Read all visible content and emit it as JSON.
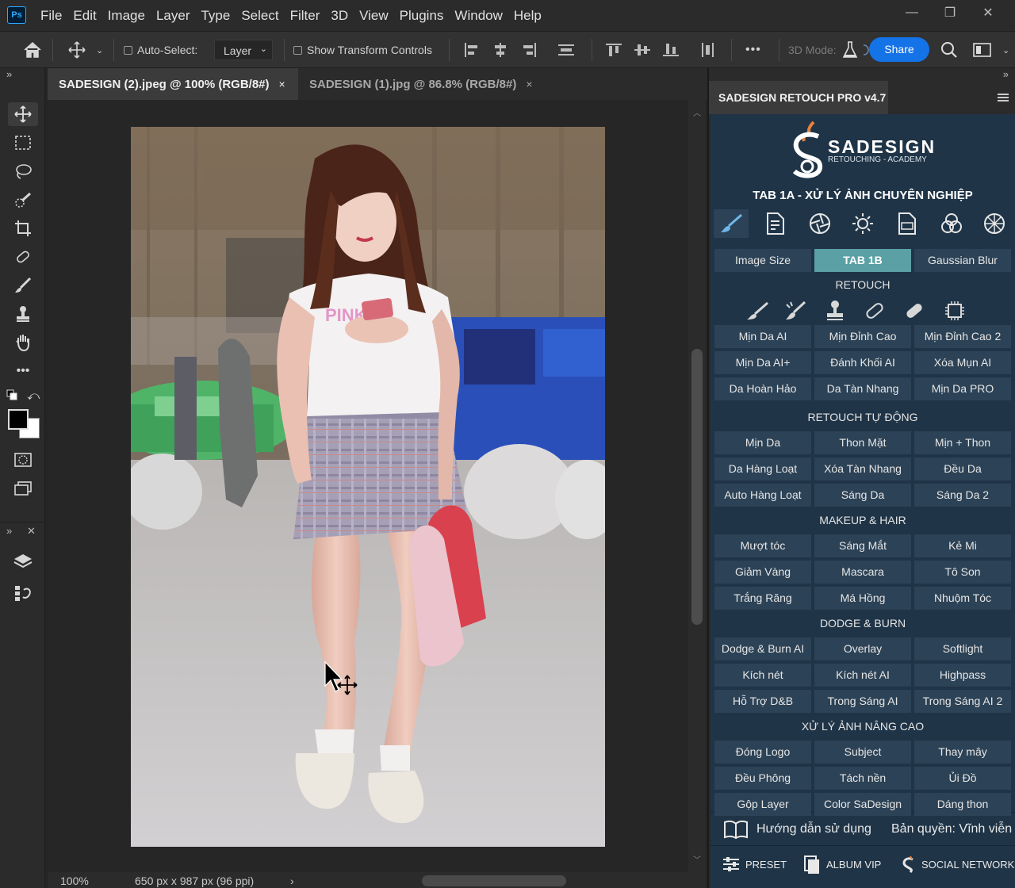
{
  "app": {
    "logo": "Ps",
    "menu": [
      "File",
      "Edit",
      "Image",
      "Layer",
      "Type",
      "Select",
      "Filter",
      "3D",
      "View",
      "Plugins",
      "Window",
      "Help"
    ],
    "window_controls": [
      "—",
      "❐",
      "✕"
    ]
  },
  "options": {
    "auto_select_label": "Auto-Select:",
    "auto_select_target": "Layer",
    "show_transform_label": "Show Transform Controls",
    "more": "•••",
    "mode_3d_label": "3D Mode:",
    "share_label": "Share"
  },
  "toolbar": {
    "collapse": "»",
    "panel_collapse": "»",
    "panel_close": "✕"
  },
  "documents": [
    {
      "title": "SADESIGN (2).jpeg @ 100% (RGB/8#)",
      "close": "×",
      "active": true
    },
    {
      "title": "SADESIGN (1).jpg @ 86.8% (RGB/8#)",
      "close": "×",
      "active": false
    }
  ],
  "status": {
    "zoom": "100%",
    "doc_info": "650 px x 987 px (96 ppi)",
    "arrow": "›"
  },
  "panel": {
    "expand": "»",
    "title": "SADESIGN RETOUCH PRO v4.7",
    "menu_icon": "hamburger-icon"
  },
  "plugin": {
    "brand_name": "SADESIGN",
    "brand_sub": "RETOUCHING - ACADEMY",
    "heading": "TAB 1A - XỬ LÝ ẢNH CHUYÊN NGHIỆP",
    "top_buttons": [
      "Image Size",
      "TAB 1B",
      "Gaussian Blur"
    ],
    "sections": [
      {
        "title": "RETOUCH",
        "rows": [
          [
            "Mịn Da AI",
            "Mịn Đỉnh Cao",
            "Mịn Đỉnh Cao 2"
          ],
          [
            "Mịn Da AI+",
            "Đánh Khối AI",
            "Xóa Mụn AI"
          ],
          [
            "Da Hoàn Hảo",
            "Da Tàn Nhang",
            "Mịn Da PRO"
          ]
        ]
      },
      {
        "title": "RETOUCH TỰ ĐỘNG",
        "rows": [
          [
            "Mịn Da",
            "Thon Mặt",
            "Mịn + Thon"
          ],
          [
            "Da Hàng Loạt",
            "Xóa Tàn Nhang",
            "Đều Da"
          ],
          [
            "Auto Hàng Loạt",
            "Sáng Da",
            "Sáng Da 2"
          ]
        ]
      },
      {
        "title": "MAKEUP & HAIR",
        "rows": [
          [
            "Mượt tóc",
            "Sáng Mắt",
            "Kẻ Mi"
          ],
          [
            "Giảm Vàng",
            "Mascara",
            "Tô Son"
          ],
          [
            "Trắng Răng",
            "Má Hồng",
            "Nhuộm Tóc"
          ]
        ]
      },
      {
        "title": "DODGE & BURN",
        "rows": [
          [
            "Dodge & Burn AI",
            "Overlay",
            "Softlight"
          ],
          [
            "Kích nét",
            "Kích nét AI",
            "Highpass"
          ],
          [
            "Hỗ Trợ D&B",
            "Trong Sáng AI",
            "Trong Sáng AI 2"
          ]
        ]
      },
      {
        "title": "XỬ LÝ ẢNH NÂNG CAO",
        "rows": [
          [
            "Đóng Logo",
            "Subject",
            "Thay mây"
          ],
          [
            "Đều Phông",
            "Tách nền",
            "Ủi Đồ"
          ],
          [
            "Gộp Layer",
            "Color SaDesign",
            "Dáng thon"
          ]
        ]
      }
    ],
    "guide_label": "Hướng dẫn sử dụng",
    "license_label": "Bản quyền: Vĩnh viễn",
    "footer": [
      "PRESET",
      "ALBUM VIP",
      "SOCIAL NETWORK"
    ],
    "colors": {
      "panel_bg": "#1f3447",
      "button_bg": "#2c4256",
      "highlight": "#5aa0a5",
      "logo_accent": "#e8823a"
    }
  }
}
